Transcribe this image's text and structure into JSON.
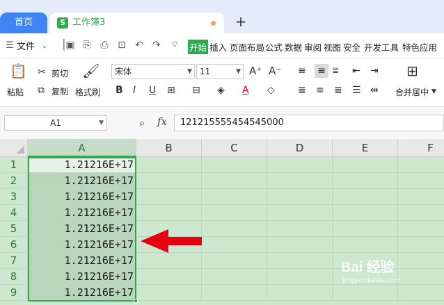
{
  "tabs": {
    "home": "首页",
    "doc_title": "工作簿3",
    "add": "+"
  },
  "menubar": {
    "file": "文件",
    "items": [
      "开始",
      "插入",
      "页面布局",
      "公式",
      "数据",
      "审阅",
      "视图",
      "安全",
      "开发工具",
      "特色应用"
    ],
    "active_index": 0
  },
  "ribbon": {
    "paste": "粘贴",
    "cut": "剪切",
    "copy": "复制",
    "format_painter": "格式刷",
    "font_name": "宋体",
    "font_size": "11",
    "merge_center": "合并居中"
  },
  "formula_bar": {
    "cell_ref": "A1",
    "fx": "fx",
    "value": "121215555454545000"
  },
  "grid": {
    "columns": [
      "A",
      "B",
      "C",
      "D",
      "E",
      "F"
    ],
    "rows": [
      "1",
      "2",
      "3",
      "4",
      "5",
      "6",
      "7",
      "8",
      "9"
    ],
    "colA_values": [
      "1.21216E+17",
      "1.21216E+17",
      "1.21216E+17",
      "1.21216E+17",
      "1.21216E+17",
      "1.21216E+17",
      "1.21216E+17",
      "1.21216E+17",
      "1.21216E+17"
    ]
  },
  "watermark": {
    "main": "Bai 经验",
    "sub": "jingyan.baidu.com"
  },
  "colors": {
    "accent_green": "#2fa84f",
    "selection_fill": "#cde8cf",
    "arrow_red": "#e60012",
    "tab_blue": "#3e84f5"
  }
}
